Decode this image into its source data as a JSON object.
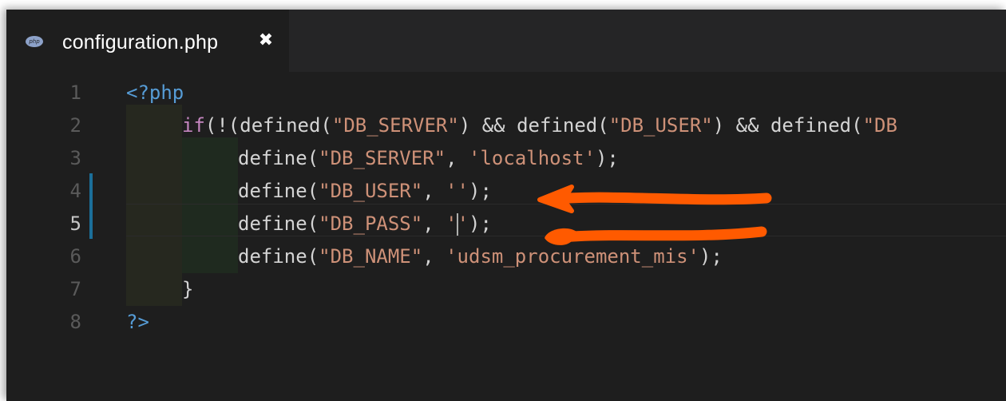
{
  "tab": {
    "icon": "php-file-icon",
    "filename": "configuration.php",
    "close_label": "✖"
  },
  "editor": {
    "lines": [
      {
        "n": "1",
        "parts": [
          {
            "t": "<?php",
            "c": "tag"
          }
        ]
      },
      {
        "n": "2",
        "parts": [
          {
            "t": "if",
            "c": "kw"
          },
          {
            "t": "(!(",
            "c": ""
          },
          {
            "t": "defined",
            "c": ""
          },
          {
            "t": "(",
            "c": ""
          },
          {
            "t": "\"DB_SERVER\"",
            "c": "str"
          },
          {
            "t": ") && ",
            "c": ""
          },
          {
            "t": "defined",
            "c": ""
          },
          {
            "t": "(",
            "c": ""
          },
          {
            "t": "\"DB_USER\"",
            "c": "str"
          },
          {
            "t": ") && ",
            "c": ""
          },
          {
            "t": "defined",
            "c": ""
          },
          {
            "t": "(",
            "c": ""
          },
          {
            "t": "\"DB",
            "c": "str"
          }
        ]
      },
      {
        "n": "3",
        "parts": [
          {
            "t": "define",
            "c": ""
          },
          {
            "t": "(",
            "c": ""
          },
          {
            "t": "\"DB_SERVER\"",
            "c": "str"
          },
          {
            "t": ", ",
            "c": ""
          },
          {
            "t": "'localhost'",
            "c": "str"
          },
          {
            "t": ");",
            "c": ""
          }
        ]
      },
      {
        "n": "4",
        "parts": [
          {
            "t": "define",
            "c": ""
          },
          {
            "t": "(",
            "c": ""
          },
          {
            "t": "\"DB_USER\"",
            "c": "str"
          },
          {
            "t": ", ",
            "c": ""
          },
          {
            "t": "''",
            "c": "str"
          },
          {
            "t": ");",
            "c": ""
          }
        ]
      },
      {
        "n": "5",
        "parts": [
          {
            "t": "define",
            "c": ""
          },
          {
            "t": "(",
            "c": ""
          },
          {
            "t": "\"DB_PASS\"",
            "c": "str"
          },
          {
            "t": ", ",
            "c": ""
          },
          {
            "t": "'",
            "c": "str"
          },
          {
            "t": "|",
            "c": "cursor"
          },
          {
            "t": "'",
            "c": "str"
          },
          {
            "t": ");",
            "c": ""
          }
        ]
      },
      {
        "n": "6",
        "parts": [
          {
            "t": "define",
            "c": ""
          },
          {
            "t": "(",
            "c": ""
          },
          {
            "t": "\"DB_NAME\"",
            "c": "str"
          },
          {
            "t": ", ",
            "c": ""
          },
          {
            "t": "'udsm_procurement_mis'",
            "c": "str"
          },
          {
            "t": ");",
            "c": ""
          }
        ]
      },
      {
        "n": "7",
        "parts": [
          {
            "t": "}",
            "c": ""
          }
        ]
      },
      {
        "n": "8",
        "parts": [
          {
            "t": "?>",
            "c": "tag"
          }
        ]
      }
    ],
    "active_line": "5",
    "modified_lines": [
      "4",
      "5"
    ]
  },
  "annotations": {
    "arrow_color": "#ff5a00",
    "arrows": [
      "arrow-pointing-at-db-user",
      "arrow-pointing-at-db-pass"
    ]
  }
}
